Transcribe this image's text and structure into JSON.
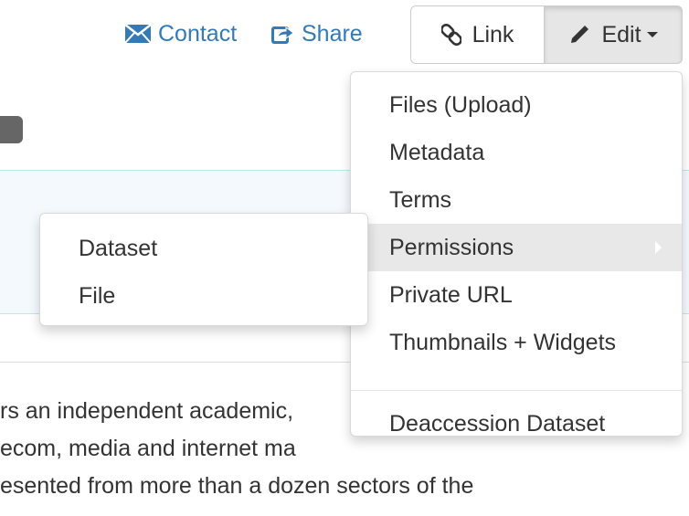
{
  "header": {
    "contact_label": "Contact",
    "share_label": "Share",
    "link_label": "Link",
    "edit_label": "Edit"
  },
  "edit_menu": {
    "items": [
      {
        "label": "Files (Upload)"
      },
      {
        "label": "Metadata"
      },
      {
        "label": "Terms"
      },
      {
        "label": "Permissions"
      },
      {
        "label": "Private URL"
      },
      {
        "label": "Thumbnails + Widgets"
      }
    ],
    "deaccession_label": "Deaccession Dataset"
  },
  "permissions_submenu": {
    "items": [
      {
        "label": "Dataset"
      },
      {
        "label": "File"
      }
    ]
  },
  "description": {
    "lines": [
      "rs an independent academic, ",
      "ecom, media and internet ma",
      "esented from more than a dozen sectors of the"
    ]
  },
  "colors": {
    "link": "#337ab7",
    "active_item_bg": "#e8e8e8",
    "panel_bg": "#f3f9fd"
  }
}
